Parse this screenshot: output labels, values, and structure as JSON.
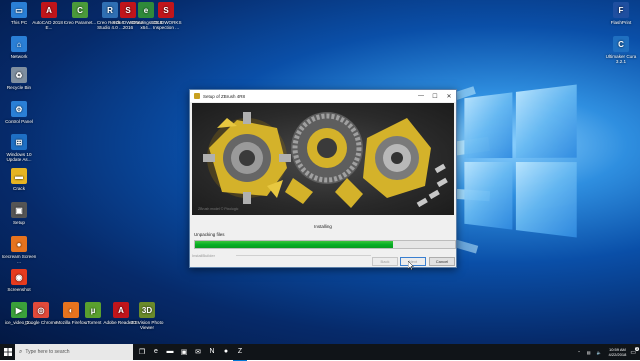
{
  "desktop": {
    "icons": [
      {
        "label": "This PC",
        "icon": "computer-icon",
        "color": "#2a7fd6",
        "glyph": "▭"
      },
      {
        "label": "AutoCAD 2018 - E...",
        "icon": "autocad-icon",
        "color": "#c0151b",
        "glyph": "A"
      },
      {
        "label": "Creo Paramet...",
        "icon": "creo-parametric-icon",
        "color": "#4a9a3a",
        "glyph": "C"
      },
      {
        "label": "Creo Render Studio 4.0 ...",
        "icon": "creo-render-icon",
        "color": "#2f6fb3",
        "glyph": "R"
      },
      {
        "label": "SOLIDWORKS 2016",
        "icon": "solidworks-icon",
        "color": "#c0151b",
        "glyph": "S"
      },
      {
        "label": "eDrawings 2016 x64...",
        "icon": "edrawings-icon",
        "color": "#2f8a3a",
        "glyph": "e"
      },
      {
        "label": "SOLIDWORKS Inspection ...",
        "icon": "solidworks-inspection-icon",
        "color": "#c0151b",
        "glyph": "S"
      },
      {
        "label": "Network",
        "icon": "network-icon",
        "color": "#2a7fd6",
        "glyph": "⌂"
      },
      {
        "label": "Recycle Bin",
        "icon": "recycle-bin-icon",
        "color": "#7f8fa0",
        "glyph": "♻"
      },
      {
        "label": "Control Panel",
        "icon": "control-panel-icon",
        "color": "#2a7fd6",
        "glyph": "⚙"
      },
      {
        "label": "Windows 10 Update As...",
        "icon": "windows-update-icon",
        "color": "#1e6fc4",
        "glyph": "⊞"
      },
      {
        "label": "Crack",
        "icon": "folder-icon",
        "color": "#e6b422",
        "glyph": "▬"
      },
      {
        "label": "Setup",
        "icon": "setup-icon",
        "color": "#555555",
        "glyph": "▣"
      },
      {
        "label": "Icecream Screen ...",
        "icon": "icecream-icon",
        "color": "#e6731e",
        "glyph": "●"
      },
      {
        "label": "Screenshot",
        "icon": "screenshot-icon",
        "color": "#e63b1e",
        "glyph": "◉"
      },
      {
        "label": "ice_video_2...",
        "icon": "video-file-icon",
        "color": "#3aa13a",
        "glyph": "▶"
      },
      {
        "label": "Google Chrome",
        "icon": "chrome-icon",
        "color": "#e04a3a",
        "glyph": "◎"
      },
      {
        "label": "Mozilla Firefox",
        "icon": "firefox-icon",
        "color": "#e6731e",
        "glyph": "◐"
      },
      {
        "label": "uTorrent",
        "icon": "utorrent-icon",
        "color": "#5aa02e",
        "glyph": "µ"
      },
      {
        "label": "Adobe Reader XI",
        "icon": "adobe-reader-icon",
        "color": "#c0151b",
        "glyph": "A"
      },
      {
        "label": "3D Vision Photo Viewer",
        "icon": "3d-vision-icon",
        "color": "#6a8a2a",
        "glyph": "3D"
      },
      {
        "label": "FlashPrint",
        "icon": "flashprint-icon",
        "color": "#1f4fa0",
        "glyph": "F"
      },
      {
        "label": "Ultimaker Cura 3.2.1",
        "icon": "cura-icon",
        "color": "#1f6fc0",
        "glyph": "C"
      }
    ]
  },
  "dialog": {
    "title": "Setup of ZBrush 4R8",
    "minimize_glyph": "—",
    "maximize_glyph": "☐",
    "close_glyph": "✕",
    "watermark": "ZBrush model © Pixologic",
    "status": "Installing",
    "detail": "Unpacking files",
    "progress_percent": 76,
    "installable_label": "InstallBuilder",
    "buttons": {
      "back": "Back",
      "next": "Next",
      "cancel": "Cancel"
    }
  },
  "taskbar": {
    "search_placeholder": "Type here to search",
    "apps": [
      {
        "icon": "task-view-icon",
        "glyph": "❐"
      },
      {
        "icon": "edge-icon",
        "glyph": "e"
      },
      {
        "icon": "file-explorer-icon",
        "glyph": "▬"
      },
      {
        "icon": "store-icon",
        "glyph": "▣"
      },
      {
        "icon": "mail-icon",
        "glyph": "✉"
      },
      {
        "icon": "onenote-icon",
        "glyph": "N"
      },
      {
        "icon": "icecream-taskbar-icon",
        "glyph": "●"
      },
      {
        "icon": "zbrush-setup-taskbar-icon",
        "glyph": "Z"
      }
    ],
    "time": "10:59 AM",
    "date": "4/22/2018",
    "notification_badge": "3"
  },
  "colors": {
    "accent": "#0078d7",
    "progress": "#06b025"
  }
}
